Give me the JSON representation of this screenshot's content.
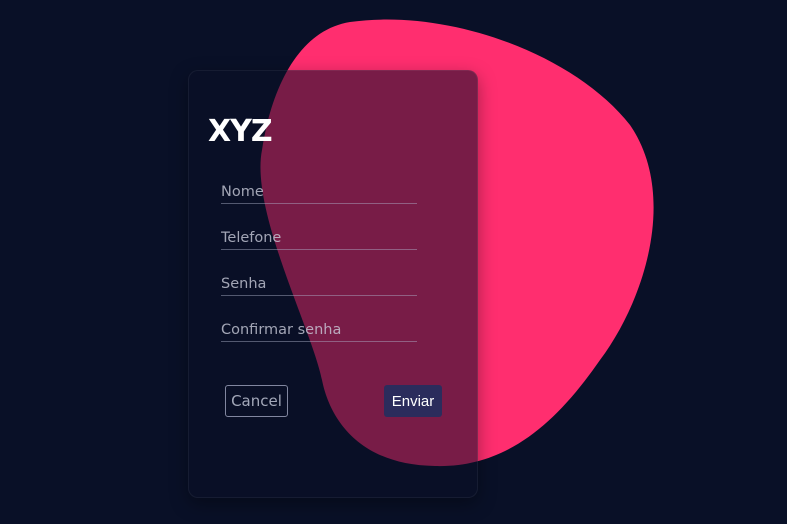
{
  "brand": {
    "title": "XYZ"
  },
  "form": {
    "fields": [
      {
        "placeholder": "Nome",
        "value": ""
      },
      {
        "placeholder": "Telefone",
        "value": ""
      },
      {
        "placeholder": "Senha",
        "value": ""
      },
      {
        "placeholder": "Confirmar senha",
        "value": ""
      }
    ],
    "cancel_label": "Cancel",
    "submit_label": "Enviar"
  },
  "colors": {
    "background": "#091027",
    "blob": "#ff2e6f",
    "submit_button": "#2b2c5c"
  }
}
